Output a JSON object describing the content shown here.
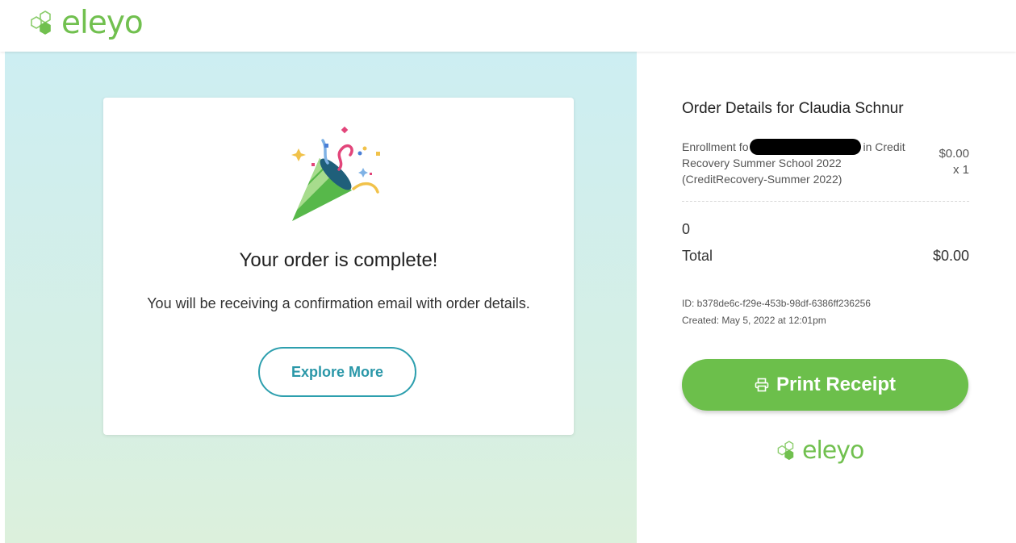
{
  "brand": {
    "logo_text": "eleyo",
    "color": "#71c04f"
  },
  "confirmation": {
    "title": "Your order is complete!",
    "message": "You will be receiving a confirmation email with order details.",
    "explore_label": "Explore More",
    "icon": "party-popper-icon"
  },
  "order": {
    "title": "Order Details for Claudia Schnur",
    "item": {
      "desc_before": "Enrollment fo",
      "desc_after": "in Credit Recovery Summer School 2022 (CreditRecovery-Summer 2022)",
      "price": "$0.00",
      "qty": "x 1"
    },
    "subtotal_value": "0",
    "total_label": "Total",
    "total_value": "$0.00",
    "id_line": "ID: b378de6c-f29e-453b-98df-6386ff236256",
    "created_line": "Created: May 5, 2022 at 12:01pm",
    "print_label": "Print Receipt"
  },
  "colors": {
    "accent_teal": "#2d9fae",
    "print_green": "#6cbf4b"
  }
}
